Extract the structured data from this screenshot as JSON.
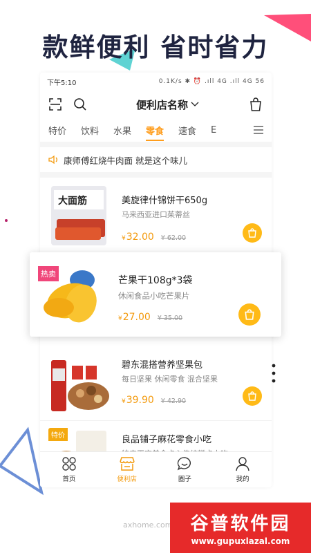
{
  "headline": "款鲜便利  省时省力",
  "status_bar": {
    "time": "下午5:10",
    "right": "0.1K/s ✱ ⏰ .ıll 4G .ıll 4G 56"
  },
  "header": {
    "store_name": "便利店名称"
  },
  "tabs": [
    {
      "label": "特价",
      "active": false
    },
    {
      "label": "饮料",
      "active": false
    },
    {
      "label": "水果",
      "active": false
    },
    {
      "label": "零食",
      "active": true
    },
    {
      "label": "速食",
      "active": false
    },
    {
      "label": "E",
      "active": false
    }
  ],
  "notice": {
    "text": "康师傅红烧牛肉面 就是这个味儿"
  },
  "products": [
    {
      "name": "美旋律什锦饼干650g",
      "sub": "马来西亚进口茱蒂丝",
      "currency": "¥",
      "price": "32.00",
      "old_price": "¥ 62.00",
      "badge": ""
    },
    {
      "name": "碧东混搭营养坚果包",
      "sub": "每日坚果 休闲零食 混合坚果",
      "currency": "¥",
      "price": "39.90",
      "old_price": "¥ 42.90",
      "badge": ""
    },
    {
      "name": "良品铺子麻花零食小吃",
      "sub": "特产正宗美食点心传统糕点小吃",
      "currency": "¥",
      "price": "",
      "old_price": "",
      "badge": "特价"
    }
  ],
  "featured": {
    "badge": "热卖",
    "name": "芒果干108g*3袋",
    "sub": "休闲食品小吃芒果片",
    "currency": "¥",
    "price": "27.00",
    "old_price": "¥ 35.00"
  },
  "product_images": [
    {
      "label": "大面筋"
    }
  ],
  "tabbar": [
    {
      "label": "首页",
      "icon": "grid-circles-icon",
      "active": false
    },
    {
      "label": "便利店",
      "icon": "store-icon",
      "active": true
    },
    {
      "label": "圈子",
      "icon": "chat-bubble-icon",
      "active": false
    },
    {
      "label": "我的",
      "icon": "user-icon",
      "active": false
    }
  ],
  "watermark": {
    "site": "axhome.com",
    "title": "谷普软件园",
    "url": "www.gupuxlazal.com"
  },
  "colors": {
    "accent": "#ff9d1c",
    "cart": "#ffba17",
    "hot": "#f0467a",
    "headline": "#1f2440"
  }
}
